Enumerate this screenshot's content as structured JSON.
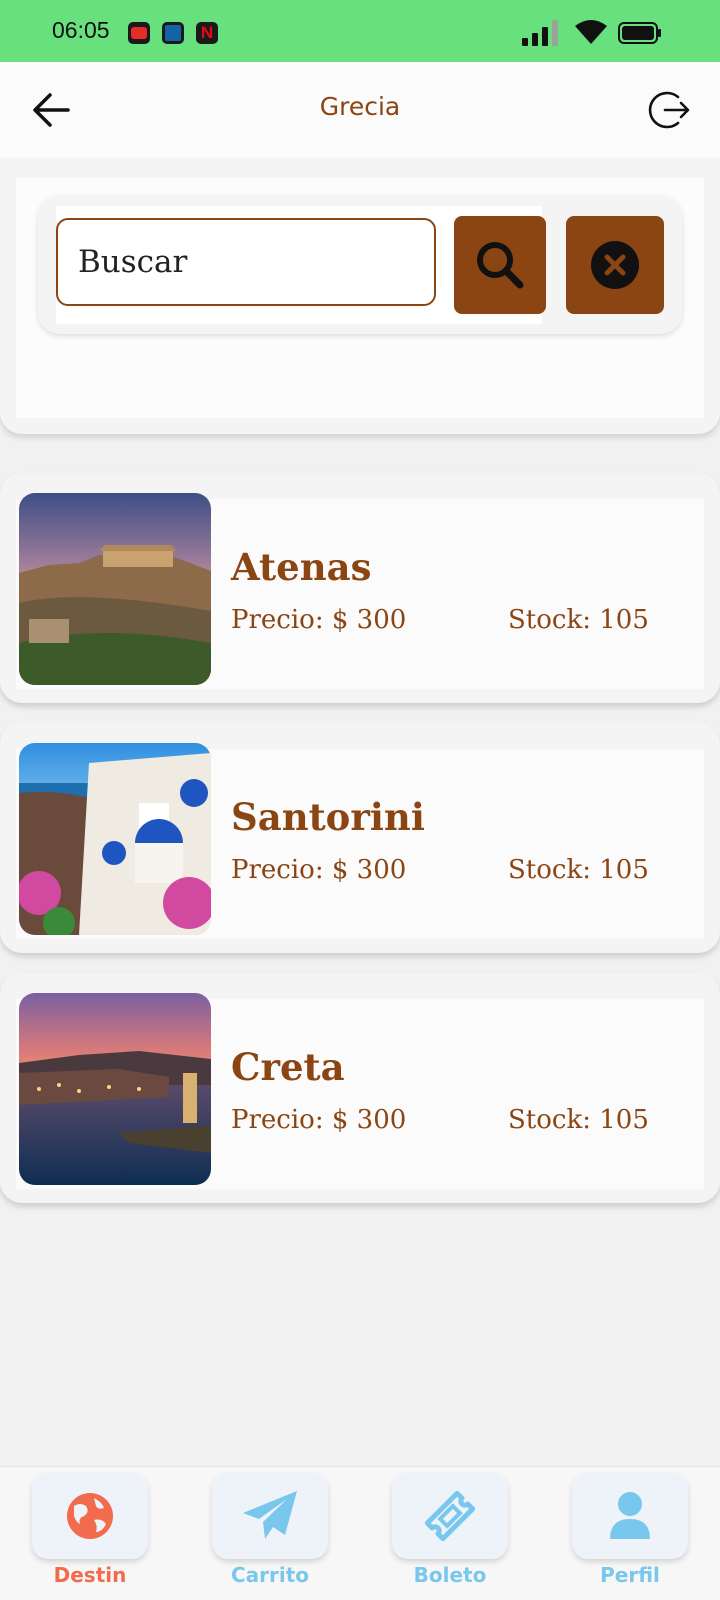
{
  "status_bar": {
    "time": "06:05",
    "apps": [
      "youtube-icon",
      "bbva-icon",
      "netflix-icon"
    ]
  },
  "header": {
    "title": "Grecia",
    "back_icon": "arrow-left-icon",
    "logout_icon": "logout-icon"
  },
  "search": {
    "placeholder": "Buscar",
    "value": ""
  },
  "destinations": [
    {
      "name": "Atenas",
      "price": "Precio: $ 300",
      "stock": "Stock: 105"
    },
    {
      "name": "Santorini",
      "price": "Precio: $ 300",
      "stock": "Stock: 105"
    },
    {
      "name": "Creta",
      "price": "Precio: $ 300",
      "stock": "Stock: 105"
    }
  ],
  "bottom_nav": [
    {
      "label": "Destin",
      "icon": "globe-icon",
      "active": true
    },
    {
      "label": "Carrito",
      "icon": "paper-plane-icon",
      "active": false
    },
    {
      "label": "Boleto",
      "icon": "ticket-icon",
      "active": false
    },
    {
      "label": "Perfil",
      "icon": "user-icon",
      "active": false
    }
  ],
  "colors": {
    "status_bar": "#68e07e",
    "brand_brown": "#8b4513",
    "nav_active": "#f26b4d",
    "nav_inactive": "#79c7ec",
    "nav_tile": "#edf3f9"
  }
}
